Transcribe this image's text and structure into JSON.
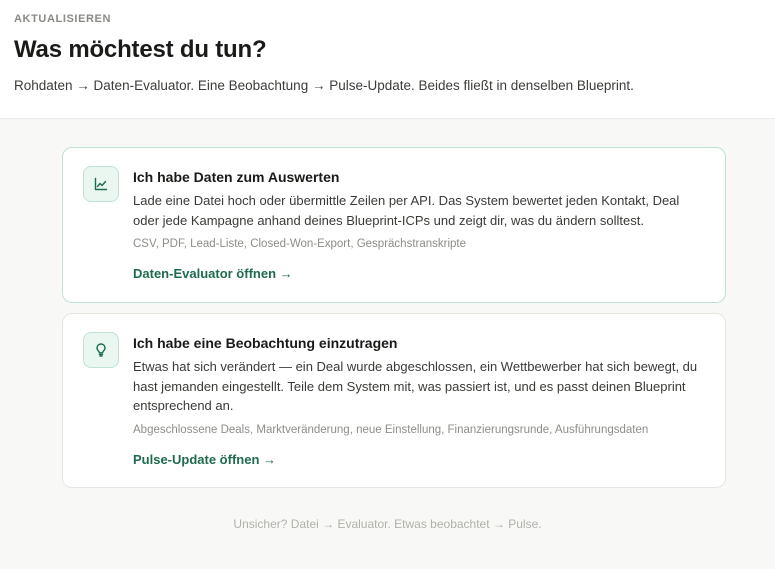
{
  "header": {
    "eyebrow": "AKTUALISIEREN",
    "title": "Was möchtest du tun?",
    "subtitle": "Rohdaten → Daten-Evaluator. Eine Beobachtung → Pulse-Update. Beides fließt in denselben Blueprint."
  },
  "options": [
    {
      "icon": "line-chart-icon",
      "title": "Ich habe Daten zum Auswerten",
      "description": "Lade eine Datei hoch oder übermittle Zeilen per API. Das System bewertet jeden Kontakt, Deal oder jede Kampagne anhand deines Blueprint-ICPs und zeigt dir, was du ändern solltest.",
      "tags": "CSV, PDF, Lead-Liste, Closed-Won-Export, Gesprächstranskripte",
      "link": "Daten-Evaluator öffnen →"
    },
    {
      "icon": "lightbulb-icon",
      "title": "Ich habe eine Beobachtung einzutragen",
      "description": "Etwas hat sich verändert — ein Deal wurde abgeschlossen, ein Wettbewerber hat sich bewegt, du hast jemanden eingestellt. Teile dem System mit, was passiert ist, und es passt deinen Blueprint entsprechend an.",
      "tags": "Abgeschlossene Deals, Marktveränderung, neue Einstellung, Finanzierungsrunde, Ausführungsdaten",
      "link": "Pulse-Update öffnen →"
    }
  ],
  "footer": {
    "note": "Unsicher? Datei → Evaluator. Etwas beobachtet → Pulse."
  },
  "colors": {
    "accent": "#1e6b4e",
    "accent_bg": "#e9f7f0",
    "accent_border": "#bfe3d3"
  }
}
